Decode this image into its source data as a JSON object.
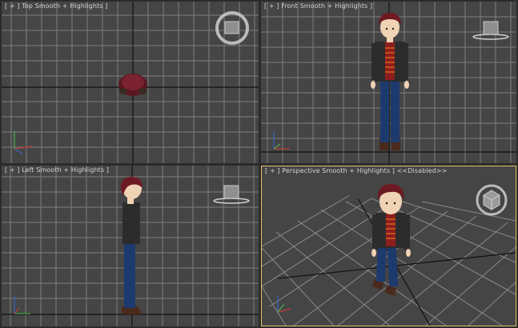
{
  "viewports": {
    "top": {
      "label_plus": "[ + ]",
      "label_view": "Top",
      "label_shading": "Smooth + Highlights ]"
    },
    "front": {
      "label_plus": "[ + ]",
      "label_view": "Front",
      "label_shading": "Smooth + Highlights ]"
    },
    "left": {
      "label_plus": "[ + ]",
      "label_view": "Left",
      "label_shading": "Smooth + Highlights ]"
    },
    "perspective": {
      "label_plus": "[ + ]",
      "label_view": "Perspective",
      "label_shading": "Smooth + Highlights ] <<Disabled>>"
    }
  },
  "colors": {
    "viewport_bg": "#454545",
    "grid": "#7a7a7a",
    "axis": "#111111",
    "active_border": "#e2c46a",
    "hair": "#6e1a22",
    "jacket": "#2c2c2c",
    "shirt_stripe": "#d6641a",
    "shirt": "#8c1e1e",
    "jeans": "#1d3a6e",
    "skin": "#f0d2b4",
    "shoes": "#5a3420"
  },
  "icons": {
    "viewcube": "viewcube-icon",
    "gizmo": "axis-gizmo-icon"
  }
}
